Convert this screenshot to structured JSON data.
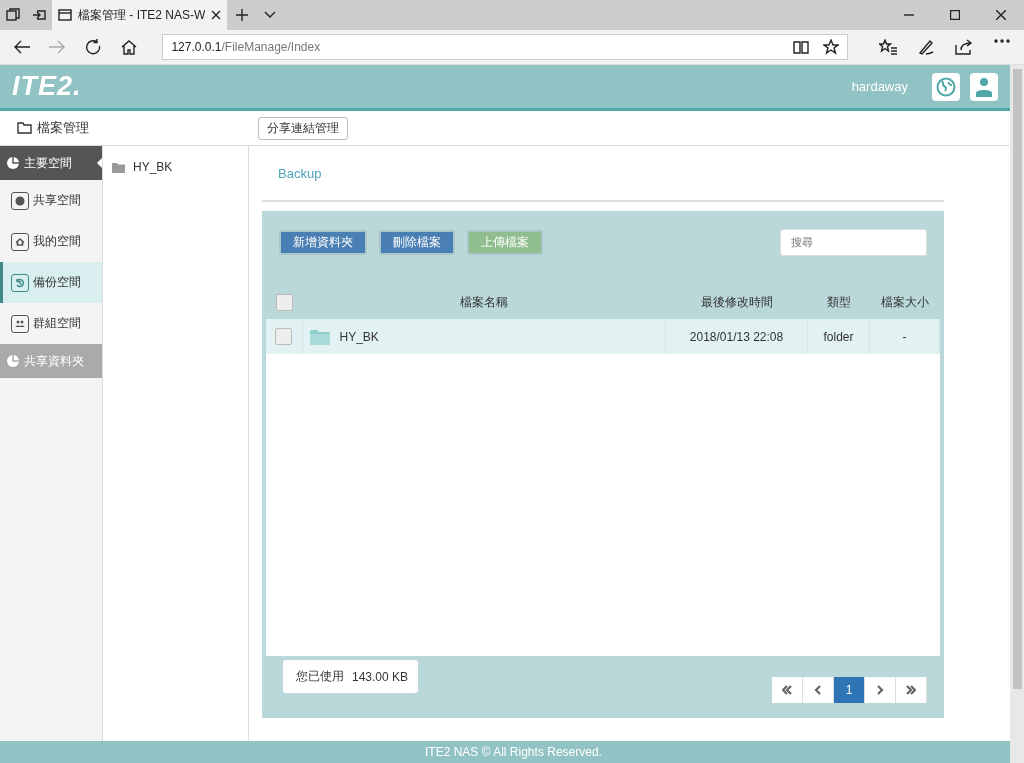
{
  "browser": {
    "tab_title": "檔案管理 - ITE2 NAS-W",
    "address_host": "127.0.0.1",
    "address_path": "/FileManage/Index"
  },
  "header": {
    "logo": "ITE2.",
    "username": "hardaway"
  },
  "toolbar": {
    "title": "檔案管理",
    "share_button": "分享連結管理"
  },
  "sidebar": {
    "items": [
      {
        "label": "主要空間",
        "kind": "section",
        "expanded": true
      },
      {
        "label": "共享空間",
        "kind": "item",
        "selected": false
      },
      {
        "label": "我的空間",
        "kind": "item",
        "selected": false
      },
      {
        "label": "備份空間",
        "kind": "item",
        "selected": true
      },
      {
        "label": "群組空間",
        "kind": "item",
        "selected": false
      },
      {
        "label": "共享資料夾",
        "kind": "section",
        "expanded": false
      }
    ]
  },
  "tree": {
    "items": [
      {
        "label": "HY_BK"
      }
    ]
  },
  "breadcrumb": "Backup",
  "actions": [
    {
      "label": "新增資料夾",
      "kind": "primary"
    },
    {
      "label": "刪除檔案",
      "kind": "primary"
    },
    {
      "label": "上傳檔案",
      "kind": "success"
    }
  ],
  "search": {
    "placeholder": "搜尋"
  },
  "table": {
    "select_all": false,
    "columns": [
      "檔案名稱",
      "最後修改時間",
      "類型",
      "檔案大小"
    ],
    "rows": [
      {
        "name": "HY_BK",
        "modified": "2018/01/13 22:08",
        "type": "folder",
        "size": "-",
        "checked": false,
        "selected": true
      }
    ]
  },
  "usage": {
    "label": "您已使用",
    "value": "143.00 KB"
  },
  "pagination": {
    "pages": [
      {
        "label": "1",
        "selected": true
      }
    ]
  },
  "footer": "ITE2 NAS © All Rights Reserved."
}
